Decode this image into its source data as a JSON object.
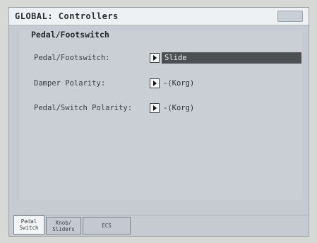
{
  "window": {
    "title": "GLOBAL: Controllers"
  },
  "section": {
    "title": "Pedal/Footswitch"
  },
  "rows": [
    {
      "label": "Pedal/Footswitch:",
      "value": "Slide"
    },
    {
      "label": "Damper Polarity:",
      "value": "-(Korg)"
    },
    {
      "label": "Pedal/Switch Polarity:",
      "value": "-(Korg)"
    }
  ],
  "tabs": [
    {
      "line1": "Pedal",
      "line2": "Switch"
    },
    {
      "line1": "Knob/",
      "line2": "Sliders"
    },
    {
      "line1": "ECS",
      "line2": ""
    }
  ],
  "colors": {
    "selected_value_bg": "#4c5053"
  }
}
